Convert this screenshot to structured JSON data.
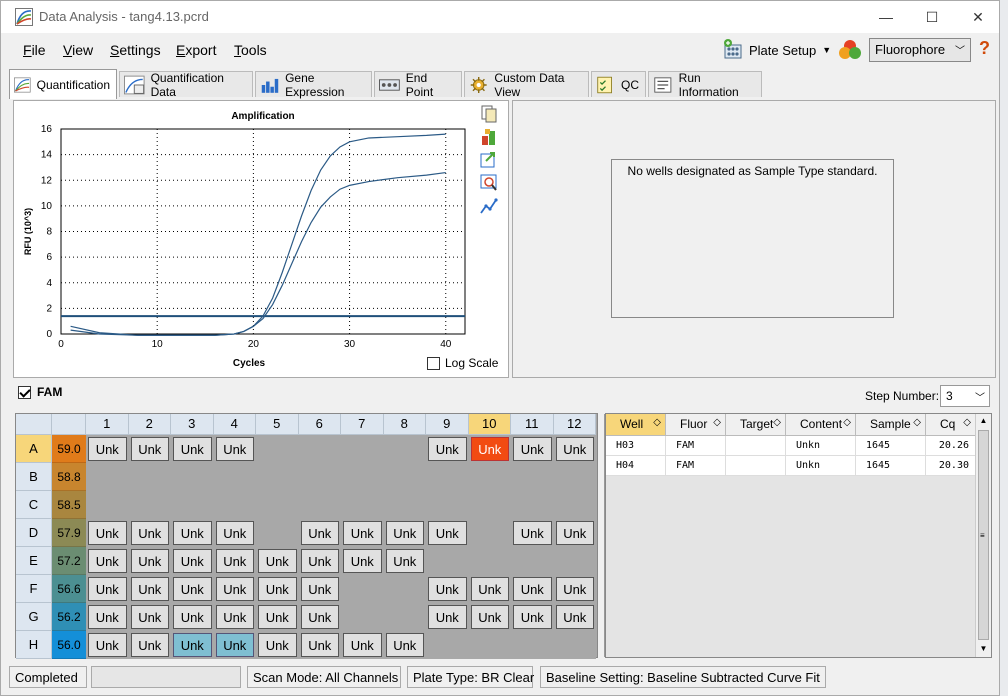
{
  "window": {
    "title": "Data Analysis - tang4.13.pcrd"
  },
  "menu": [
    {
      "label": "File",
      "key": "F"
    },
    {
      "label": "View",
      "key": "V"
    },
    {
      "label": "Settings",
      "key": "S"
    },
    {
      "label": "Export",
      "key": "E"
    },
    {
      "label": "Tools",
      "key": "T"
    }
  ],
  "toolbar": {
    "plate_setup": "Plate Setup",
    "fluorophore": "Fluorophore"
  },
  "tabs": [
    "Quantification",
    "Quantification Data",
    "Gene Expression",
    "End Point",
    "Custom Data View",
    "QC",
    "Run Information"
  ],
  "chart_data": {
    "type": "line",
    "title": "Amplification",
    "xlabel": "Cycles",
    "ylabel": "RFU (10^3)",
    "xlim": [
      0,
      42
    ],
    "ylim": [
      0,
      16
    ],
    "xticks": [
      0,
      10,
      20,
      30,
      40
    ],
    "yticks": [
      0,
      2,
      4,
      6,
      8,
      10,
      12,
      14,
      16
    ],
    "grid": true,
    "threshold": 1.4,
    "series": [
      {
        "x": [
          1,
          4,
          8,
          12,
          16,
          18,
          19,
          20,
          21,
          22,
          23,
          24,
          25,
          26,
          27,
          28,
          29,
          30,
          32,
          35,
          38,
          40
        ],
        "y": [
          0.6,
          0.1,
          -0.1,
          -0.1,
          -0.1,
          0.0,
          0.2,
          0.6,
          1.4,
          2.8,
          4.8,
          7.0,
          9.2,
          11.2,
          12.8,
          13.9,
          14.6,
          15.0,
          15.3,
          15.4,
          15.5,
          15.6
        ]
      },
      {
        "x": [
          1,
          4,
          8,
          12,
          16,
          18,
          19,
          20,
          21,
          22,
          23,
          24,
          25,
          26,
          27,
          28,
          29,
          30,
          32,
          35,
          38,
          40
        ],
        "y": [
          0.3,
          0.0,
          -0.1,
          -0.1,
          -0.1,
          0.0,
          0.2,
          0.6,
          1.2,
          2.3,
          3.8,
          5.5,
          7.2,
          8.7,
          9.9,
          10.7,
          11.3,
          11.6,
          11.9,
          12.2,
          12.4,
          12.6
        ]
      }
    ],
    "log_scale_label": "Log Scale",
    "log_scale": false
  },
  "standard_message": "No wells designated as Sample Type standard.",
  "fluor_channel": {
    "label": "FAM",
    "checked": true
  },
  "step": {
    "label": "Step Number:",
    "value": "3"
  },
  "plate": {
    "columns": [
      "1",
      "2",
      "3",
      "4",
      "5",
      "6",
      "7",
      "8",
      "9",
      "10",
      "11",
      "12"
    ],
    "highlight_col": "10",
    "highlight_row": "A",
    "rows": [
      {
        "label": "A",
        "temp": "59.0",
        "wells": [
          "Unk",
          "Unk",
          "Unk",
          "Unk",
          "",
          "",
          "",
          "",
          "Unk",
          "Unk",
          "Unk",
          "Unk"
        ]
      },
      {
        "label": "B",
        "temp": "58.8",
        "wells": [
          "",
          "",
          "",
          "",
          "",
          "",
          "",
          "",
          "",
          "",
          "",
          ""
        ]
      },
      {
        "label": "C",
        "temp": "58.5",
        "wells": [
          "",
          "",
          "",
          "",
          "",
          "",
          "",
          "",
          "",
          "",
          "",
          ""
        ]
      },
      {
        "label": "D",
        "temp": "57.9",
        "wells": [
          "Unk",
          "Unk",
          "Unk",
          "Unk",
          "",
          "Unk",
          "Unk",
          "Unk",
          "Unk",
          "",
          "Unk",
          "Unk"
        ]
      },
      {
        "label": "E",
        "temp": "57.2",
        "wells": [
          "Unk",
          "Unk",
          "Unk",
          "Unk",
          "Unk",
          "Unk",
          "Unk",
          "Unk",
          "",
          "",
          "",
          ""
        ]
      },
      {
        "label": "F",
        "temp": "56.6",
        "wells": [
          "Unk",
          "Unk",
          "Unk",
          "Unk",
          "Unk",
          "Unk",
          "",
          "",
          "Unk",
          "Unk",
          "Unk",
          "Unk"
        ]
      },
      {
        "label": "G",
        "temp": "56.2",
        "wells": [
          "Unk",
          "Unk",
          "Unk",
          "Unk",
          "Unk",
          "Unk",
          "",
          "",
          "Unk",
          "Unk",
          "Unk",
          "Unk"
        ]
      },
      {
        "label": "H",
        "temp": "56.0",
        "wells": [
          "Unk",
          "Unk",
          "Unk",
          "Unk",
          "Unk",
          "Unk",
          "Unk",
          "Unk",
          "",
          "",
          "",
          ""
        ]
      }
    ],
    "temp_colors": [
      "#e07b1a",
      "#c8852e",
      "#a9863f",
      "#8c8a55",
      "#6b8d72",
      "#4c8f92",
      "#2f8fb5",
      "#148fd8"
    ],
    "selected_wells": [
      "A10"
    ],
    "blue_wells": [
      "H3",
      "H4"
    ]
  },
  "results": {
    "headers": [
      "Well",
      "Fluor",
      "Target",
      "Content",
      "Sample",
      "Cq"
    ],
    "rows": [
      [
        "H03",
        "FAM",
        "",
        "Unkn",
        "1645",
        "20.26"
      ],
      [
        "H04",
        "FAM",
        "",
        "Unkn",
        "1645",
        "20.30"
      ]
    ]
  },
  "status": {
    "state": "Completed",
    "scan_mode": "Scan Mode: All Channels",
    "plate_type": "Plate Type: BR Clear",
    "baseline": "Baseline Setting: Baseline Subtracted Curve Fit"
  }
}
